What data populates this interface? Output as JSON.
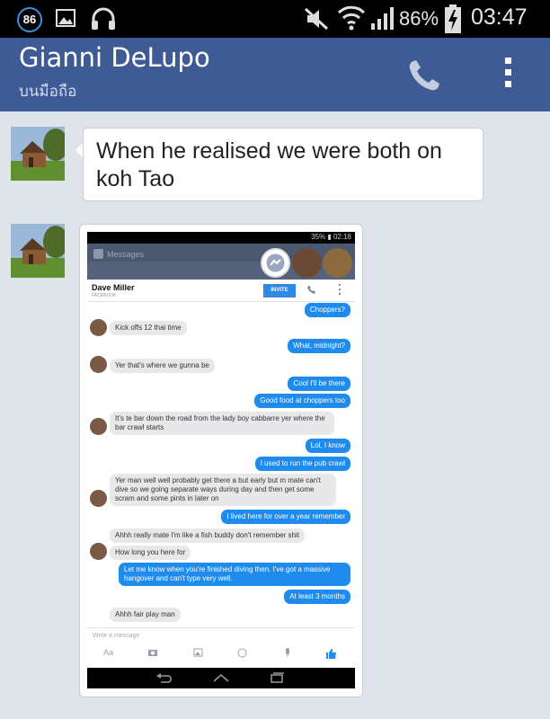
{
  "status_bar": {
    "notification_count": "86",
    "battery": "86%",
    "time": "03:47"
  },
  "header": {
    "name": "Gianni DeLupo",
    "subtitle": "บนมือถือ"
  },
  "messages": [
    {
      "text": "When he realised we were both on koh Tao"
    }
  ],
  "screenshot": {
    "status_time": "35% ▮ 02:18",
    "app_title": "Messages",
    "contact_name": "Dave Miller",
    "contact_source": "FACEBOOK",
    "invite_label": "INVITE",
    "conversation": [
      {
        "text": "Choppers?"
      },
      {
        "text": "Kick offs 12 thai time"
      },
      {
        "text": "What, midnight?"
      },
      {
        "text": "Yer that's where we gunna be"
      },
      {
        "text": "Cool I'll be there"
      },
      {
        "text": "Good food at choppers too"
      },
      {
        "text": "It's te bar down the road from the lady boy cabbarre yer where the bar crawl starts"
      },
      {
        "text": "Lol, I know"
      },
      {
        "text": "I used to run the pub crawl"
      },
      {
        "text": "Yer man well well probably get there a but early but m mate can't dive so we going separate ways during day and then get some scram and some pints in later on"
      },
      {
        "text": "I lived here for over a year remember"
      },
      {
        "text": "Ahhh really mate I'm like a fish buddy don't remember shit"
      },
      {
        "text": "How long you here for"
      },
      {
        "text": "Let me know when you're finished diving then. I've got a massive hangover and can't type very well."
      },
      {
        "text": "At least 3 months"
      },
      {
        "text": "Ahhh fair play man"
      }
    ],
    "compose_placeholder": "Write a message",
    "text_tool": "Aa"
  }
}
